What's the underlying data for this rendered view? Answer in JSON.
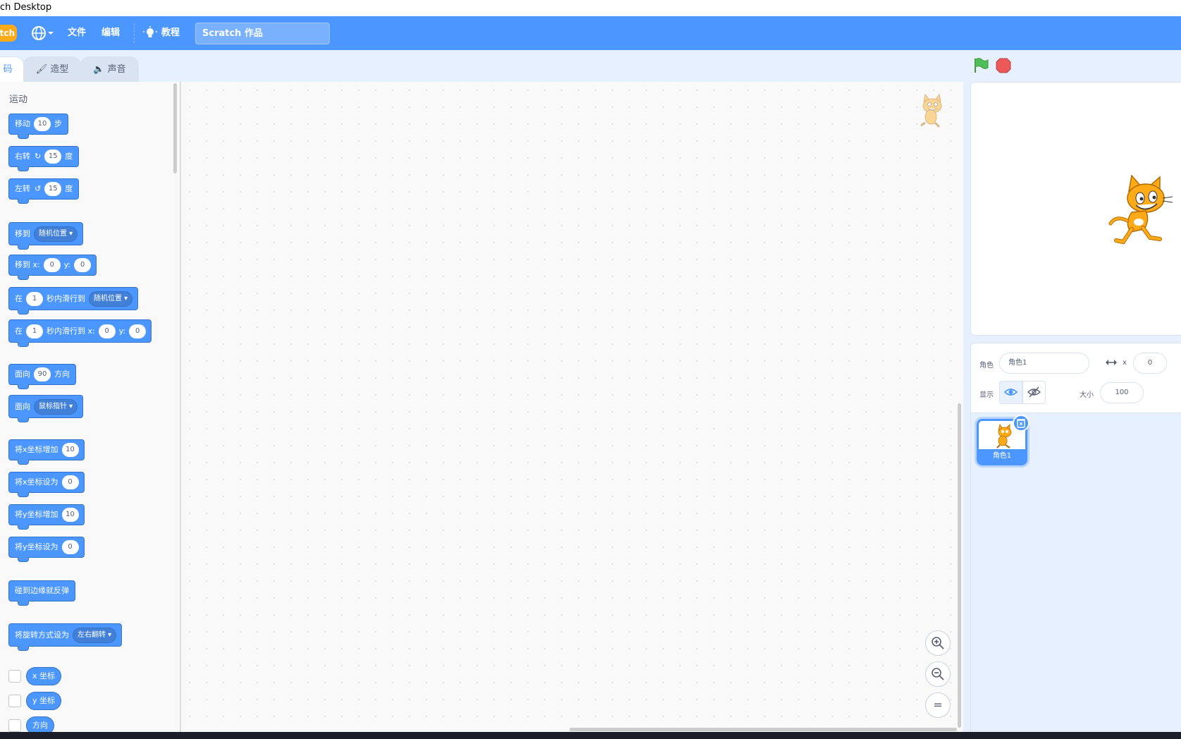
{
  "window": {
    "title": "ch Desktop"
  },
  "menu": {
    "logo_text": "tch",
    "language_icon": "globe-icon",
    "file": "文件",
    "edit": "编辑",
    "tutorials": "教程",
    "project_title": "Scratch 作品"
  },
  "tabs": {
    "code": "码",
    "costumes": "造型",
    "sounds": "声音"
  },
  "palette": {
    "category": "运动",
    "move": {
      "pre": "移动",
      "val": "10",
      "post": "步"
    },
    "turn_right": {
      "pre": "右转",
      "val": "15",
      "post": "度"
    },
    "turn_left": {
      "pre": "左转",
      "val": "15",
      "post": "度"
    },
    "goto": {
      "pre": "移到",
      "dd": "随机位置"
    },
    "goto_xy": {
      "pre": "移到 x:",
      "x": "0",
      "ylbl": "y:",
      "y": "0"
    },
    "glide": {
      "pre": "在",
      "val": "1",
      "mid": "秒内滑行到",
      "dd": "随机位置"
    },
    "glide_xy": {
      "pre": "在",
      "val": "1",
      "mid": "秒内滑行到 x:",
      "x": "0",
      "ylbl": "y:",
      "y": "0"
    },
    "point_dir": {
      "pre": "面向",
      "val": "90",
      "post": "方向"
    },
    "point_towards": {
      "pre": "面向",
      "dd": "鼠标指针"
    },
    "change_x": {
      "pre": "将x坐标增加",
      "val": "10"
    },
    "set_x": {
      "pre": "将x坐标设为",
      "val": "0"
    },
    "change_y": {
      "pre": "将y坐标增加",
      "val": "10"
    },
    "set_y": {
      "pre": "将y坐标设为",
      "val": "0"
    },
    "bounce": "碰到边缘就反弹",
    "rotation": {
      "pre": "将旋转方式设为",
      "dd": "左右翻转"
    },
    "x_pos": "x 坐标",
    "y_pos": "y 坐标",
    "direction": "方向"
  },
  "zoom": {
    "in": "+",
    "out": "−",
    "reset": "="
  },
  "sprite_info": {
    "sprite_label": "角色",
    "sprite_name": "角色1",
    "x_label": "x",
    "x_value": "0",
    "show_label": "显示",
    "size_label": "大小",
    "size_value": "100"
  },
  "sprites": [
    {
      "name": "角色1"
    }
  ],
  "colors": {
    "accent": "#4c97ff",
    "menubar": "#4c97ff",
    "motion": "#4c97ff",
    "green_flag": "#4cbf56",
    "stop": "#ec5959"
  }
}
